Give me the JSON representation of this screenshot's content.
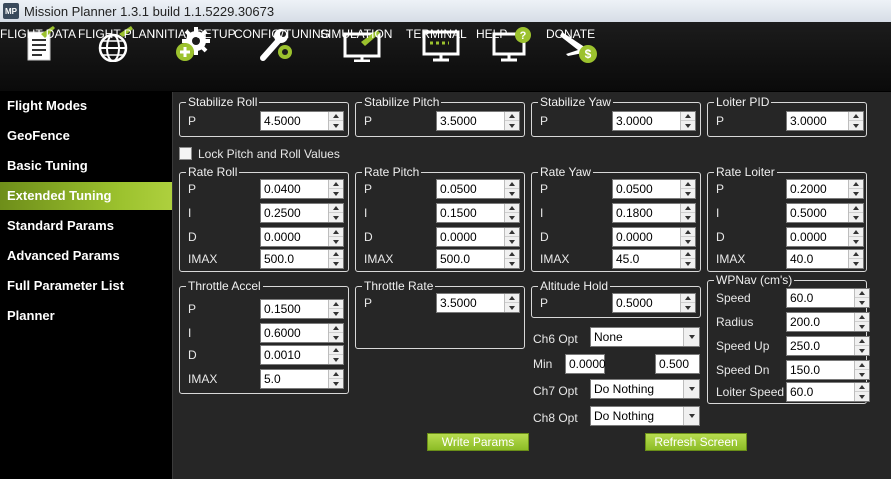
{
  "window": {
    "title": "Mission Planner 1.3.1 build 1.1.5229.30673",
    "icon_label": "MP"
  },
  "menu": [
    {
      "label": "FLIGHT DATA",
      "icon": "flight-data-icon"
    },
    {
      "label": "FLIGHT PLAN",
      "icon": "flight-plan-icon"
    },
    {
      "label": "INITIAL SETUP",
      "icon": "initial-setup-icon"
    },
    {
      "label": "CONFIG/TUNING",
      "icon": "config-tuning-icon"
    },
    {
      "label": "SIMULATION",
      "icon": "simulation-icon"
    },
    {
      "label": "TERMINAL",
      "icon": "terminal-icon"
    },
    {
      "label": "HELP",
      "icon": "help-icon"
    },
    {
      "label": "DONATE",
      "icon": "donate-icon"
    }
  ],
  "sidebar": {
    "items": [
      "Flight Modes",
      "GeoFence",
      "Basic Tuning",
      "Extended Tuning",
      "Standard Params",
      "Advanced Params",
      "Full Parameter List",
      "Planner"
    ],
    "active": "Extended Tuning"
  },
  "groups": {
    "stab_roll": {
      "title": "Stabilize Roll",
      "rows": [
        {
          "label": "P",
          "value": "4.5000"
        }
      ]
    },
    "stab_pitch": {
      "title": "Stabilize Pitch",
      "rows": [
        {
          "label": "P",
          "value": "3.5000"
        }
      ]
    },
    "stab_yaw": {
      "title": "Stabilize Yaw",
      "rows": [
        {
          "label": "P",
          "value": "3.0000"
        }
      ]
    },
    "loiter_pid": {
      "title": "Loiter PID",
      "rows": [
        {
          "label": "P",
          "value": "3.0000"
        }
      ]
    },
    "rate_roll": {
      "title": "Rate Roll",
      "rows": [
        {
          "label": "P",
          "value": "0.0400"
        },
        {
          "label": "I",
          "value": "0.2500"
        },
        {
          "label": "D",
          "value": "0.0000"
        },
        {
          "label": "IMAX",
          "value": "500.0"
        }
      ]
    },
    "rate_pitch": {
      "title": "Rate Pitch",
      "rows": [
        {
          "label": "P",
          "value": "0.0500"
        },
        {
          "label": "I",
          "value": "0.1500"
        },
        {
          "label": "D",
          "value": "0.0000"
        },
        {
          "label": "IMAX",
          "value": "500.0"
        }
      ]
    },
    "rate_yaw": {
      "title": "Rate Yaw",
      "rows": [
        {
          "label": "P",
          "value": "0.0500"
        },
        {
          "label": "I",
          "value": "0.1800"
        },
        {
          "label": "D",
          "value": "0.0000"
        },
        {
          "label": "IMAX",
          "value": "45.0"
        }
      ]
    },
    "rate_loiter": {
      "title": "Rate Loiter",
      "rows": [
        {
          "label": "P",
          "value": "0.2000"
        },
        {
          "label": "I",
          "value": "0.5000"
        },
        {
          "label": "D",
          "value": "0.0000"
        },
        {
          "label": "IMAX",
          "value": "40.0"
        }
      ]
    },
    "throttle_accel": {
      "title": "Throttle Accel",
      "rows": [
        {
          "label": "P",
          "value": "0.1500"
        },
        {
          "label": "I",
          "value": "0.6000"
        },
        {
          "label": "D",
          "value": "0.0010"
        },
        {
          "label": "IMAX",
          "value": "5.0"
        }
      ]
    },
    "throttle_rate": {
      "title": "Throttle Rate",
      "rows": [
        {
          "label": "P",
          "value": "3.5000"
        }
      ]
    },
    "altitude_hold": {
      "title": "Altitude Hold",
      "rows": [
        {
          "label": "P",
          "value": "0.5000"
        }
      ]
    },
    "wpnav": {
      "title": "WPNav (cm's)",
      "rows": [
        {
          "label": "Speed",
          "value": "60.0"
        },
        {
          "label": "Radius",
          "value": "200.0"
        },
        {
          "label": "Speed Up",
          "value": "250.0"
        },
        {
          "label": "Speed Dn",
          "value": "150.0"
        },
        {
          "label": "Loiter Speed",
          "value": "60.0"
        }
      ]
    }
  },
  "lock_checkbox": {
    "label": "Lock Pitch and Roll Values",
    "checked": false
  },
  "ch6": {
    "label": "Ch6 Opt",
    "value": "None"
  },
  "minmax": {
    "min_label": "Min",
    "min_value": "0.0000",
    "max_value": "0.500"
  },
  "ch7": {
    "label": "Ch7 Opt",
    "value": "Do Nothing"
  },
  "ch8": {
    "label": "Ch8 Opt",
    "value": "Do Nothing"
  },
  "buttons": {
    "write": "Write Params",
    "refresh": "Refresh Screen"
  }
}
